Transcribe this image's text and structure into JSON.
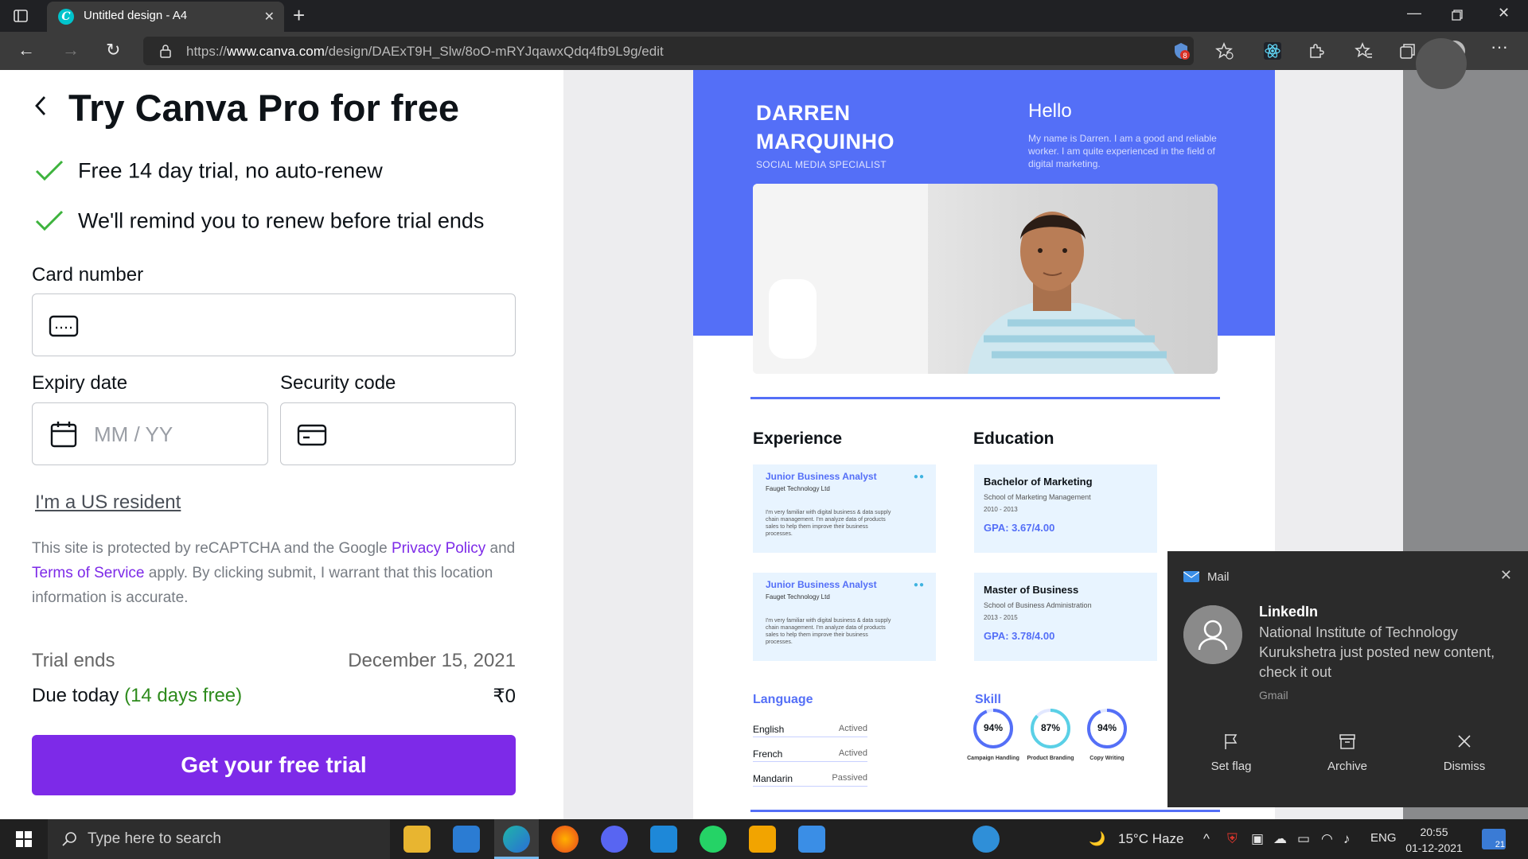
{
  "browser": {
    "tab_title": "Untitled design - A4",
    "url_prefix": "https://",
    "url_domain": "www.canva.com",
    "url_path": "/design/DAExT9H_Slw/8oO-mRYJqawxQdq4fb9L9g/edit",
    "extension_badge": "8"
  },
  "checkout": {
    "title": "Try Canva Pro for free",
    "features": [
      "Free 14 day trial, no auto-renew",
      "We'll remind you to renew before trial ends"
    ],
    "card_number_label": "Card number",
    "expiry_label": "Expiry date",
    "expiry_placeholder": "MM / YY",
    "security_label": "Security code",
    "us_resident_link": "I'm a US resident",
    "legal_pre": "This site is protected by reCAPTCHA and the Google ",
    "privacy_link": "Privacy Policy",
    "legal_mid": " and ",
    "terms_link": "Terms of Service",
    "legal_post": " apply. By clicking submit, I warrant that this location information is accurate.",
    "trial_ends_label": "Trial ends",
    "trial_ends_value": "December 15, 2021",
    "due_today_label": "Due today",
    "due_today_note": "(14 days free)",
    "due_today_value": "₹0",
    "cta_label": "Get your free trial"
  },
  "resume": {
    "name_line1": "DARREN",
    "name_line2": "MARQUINHO",
    "role": "SOCIAL MEDIA SPECIALIST",
    "hello": "Hello",
    "bio": "My name is Darren. I am a good and reliable worker. I am quite experienced in the field of digital marketing.",
    "experience_title": "Experience",
    "education_title": "Education",
    "experience": [
      {
        "title": "Junior Business Analyst",
        "company": "Fauget Technology Ltd",
        "desc": "I'm very familiar with digital business & data supply chain management. I'm analyze data of products sales to help them improve their business processes."
      },
      {
        "title": "Junior Business Analyst",
        "company": "Fauget Technology Ltd",
        "desc": "I'm very familiar with digital business & data supply chain management. I'm analyze data of products sales to help them improve their business processes."
      }
    ],
    "education": [
      {
        "degree": "Bachelor of Marketing",
        "school": "School of Marketing Management",
        "years": "2010 - 2013",
        "gpa": "GPA: 3.67/4.00"
      },
      {
        "degree": "Master of Business",
        "school": "School of Business Administration",
        "years": "2013 - 2015",
        "gpa": "GPA: 3.78/4.00"
      }
    ],
    "language_title": "Language",
    "languages": [
      {
        "name": "English",
        "level": "Actived"
      },
      {
        "name": "French",
        "level": "Actived"
      },
      {
        "name": "Mandarin",
        "level": "Passived"
      }
    ],
    "skill_title": "Skill",
    "skills": [
      {
        "value": "94%",
        "fraction": 0.94,
        "label": "Campaign Handling"
      },
      {
        "value": "87%",
        "fraction": 0.87,
        "label": "Product Branding"
      },
      {
        "value": "94%",
        "fraction": 0.94,
        "label": "Copy Writing"
      }
    ]
  },
  "notification": {
    "app": "Mail",
    "title": "LinkedIn",
    "body": "National Institute of Technology Kurukshetra just posted new content, check it out",
    "source": "Gmail",
    "actions": [
      "Set flag",
      "Archive",
      "Dismiss"
    ]
  },
  "taskbar": {
    "search_placeholder": "Type here to search",
    "weather": "15°C  Haze",
    "language": "ENG",
    "time": "20:55",
    "date": "01-12-2021",
    "notif_count": "21"
  },
  "colors": {
    "brand_purple": "#7d2ae8",
    "resume_blue": "#546ff7",
    "check_green": "#3db33d"
  }
}
